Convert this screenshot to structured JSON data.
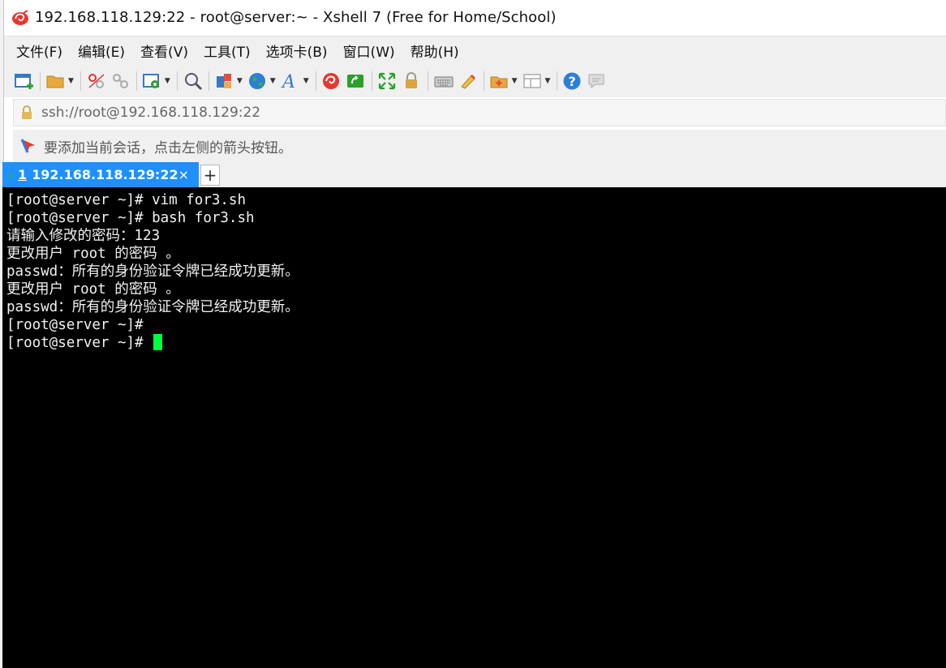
{
  "window": {
    "title": "192.168.118.129:22 - root@server:~ - Xshell 7 (Free for Home/School)",
    "app_icon": "xshell-red-swirl-icon"
  },
  "menubar": {
    "items": [
      {
        "label": "文件(F)"
      },
      {
        "label": "编辑(E)"
      },
      {
        "label": "查看(V)"
      },
      {
        "label": "工具(T)"
      },
      {
        "label": "选项卡(B)"
      },
      {
        "label": "窗口(W)"
      },
      {
        "label": "帮助(H)"
      }
    ]
  },
  "toolbar": {
    "icons": [
      "new-session-icon",
      "open-folder-icon",
      "disconnect-icon",
      "reconnect-icon",
      "properties-icon",
      "find-icon",
      "transfer-icon",
      "globe-icon",
      "font-icon",
      "xshell-icon",
      "xftp-icon",
      "fullscreen-icon",
      "lock-icon",
      "keyboard-icon",
      "highlight-icon",
      "new-tab-folder-icon",
      "layout-icon",
      "help-icon",
      "chat-icon"
    ]
  },
  "address": {
    "value": "ssh://root@192.168.118.129:22"
  },
  "hint": {
    "text": "要添加当前会话，点击左侧的箭头按钮。"
  },
  "tabs": [
    {
      "number": "1",
      "label": "192.168.118.129:22",
      "close": "×",
      "status_color": "#22c222"
    }
  ],
  "tab_add_label": "+",
  "colors": {
    "tab_active": "#1e90ff",
    "terminal_bg": "#000000",
    "cursor": "#00ff3c"
  },
  "terminal": {
    "lines": [
      "[root@server ~]# vim for3.sh",
      "[root@server ~]# bash for3.sh",
      "请输入修改的密码：123",
      "更改用户 root 的密码 。",
      "passwd：所有的身份验证令牌已经成功更新。",
      "更改用户 root 的密码 。",
      "passwd：所有的身份验证令牌已经成功更新。",
      "[root@server ~]#",
      "[root@server ~]# "
    ]
  }
}
